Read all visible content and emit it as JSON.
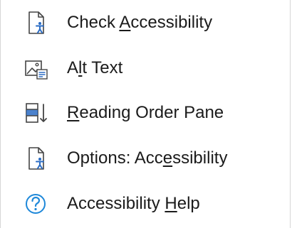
{
  "menu": {
    "items": [
      {
        "icon": "check-accessibility-icon",
        "label": {
          "before": "Check ",
          "key": "A",
          "after": "ccessibility"
        }
      },
      {
        "icon": "alt-text-icon",
        "label": {
          "before": "A",
          "key": "l",
          "after": "t Text"
        }
      },
      {
        "icon": "reading-order-pane-icon",
        "label": {
          "before": "",
          "key": "R",
          "after": "eading Order Pane"
        }
      },
      {
        "icon": "options-accessibility-icon",
        "label": {
          "before": "Options: Acc",
          "key": "e",
          "after": "ssibility"
        }
      },
      {
        "icon": "help-icon",
        "label": {
          "before": "Accessibility ",
          "key": "H",
          "after": "elp"
        }
      }
    ]
  },
  "colors": {
    "icon_stroke": "#444444",
    "icon_accent_blue": "#2b6cc4",
    "help_blue": "#1e88d9",
    "text": "#1b1b1b"
  }
}
